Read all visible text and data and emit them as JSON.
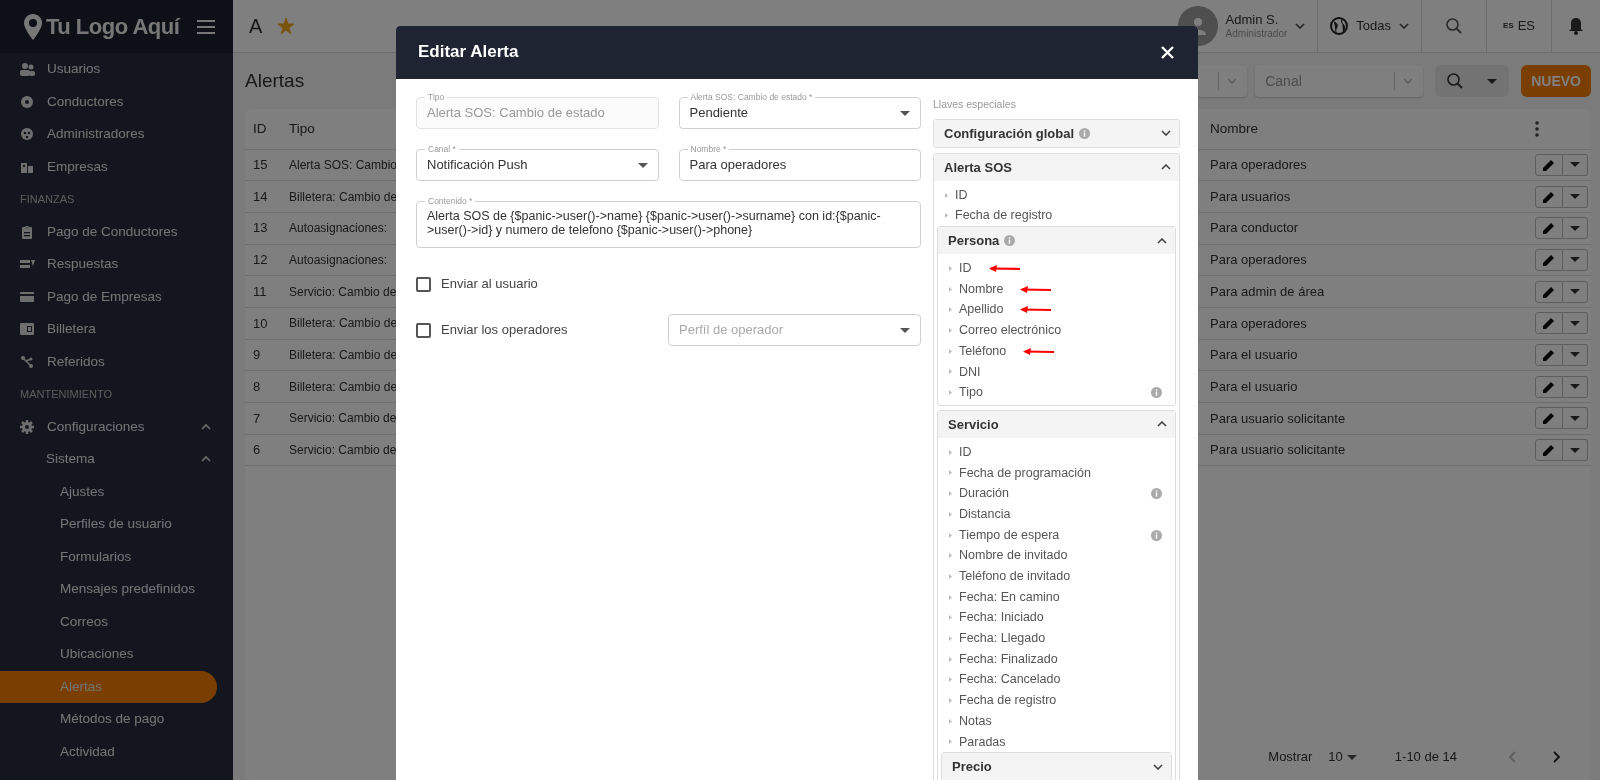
{
  "sidebar": {
    "logo": "Tu Logo Aquí",
    "nav": [
      {
        "kind": "item",
        "label": "Usuarios"
      },
      {
        "kind": "item",
        "label": "Conductores"
      },
      {
        "kind": "item",
        "label": "Administradores"
      },
      {
        "kind": "item",
        "label": "Empresas"
      },
      {
        "kind": "section",
        "label": "FINANZAS"
      },
      {
        "kind": "item",
        "label": "Pago de Conductores"
      },
      {
        "kind": "item",
        "label": "Respuestas"
      },
      {
        "kind": "item",
        "label": "Pago de Empresas"
      },
      {
        "kind": "item",
        "label": "Billetera"
      },
      {
        "kind": "item",
        "label": "Referidos"
      },
      {
        "kind": "section",
        "label": "MANTENIMIENTO"
      },
      {
        "kind": "item",
        "label": "Configuraciones",
        "expanded": true,
        "children": [
          {
            "kind": "item",
            "label": "Sistema",
            "expanded": true,
            "children": [
              {
                "kind": "item",
                "label": "Ajustes",
                "selected": false
              },
              {
                "kind": "item",
                "label": "Perfiles de usuario",
                "selected": false
              },
              {
                "kind": "item",
                "label": "Formularios",
                "selected": false
              },
              {
                "kind": "item",
                "label": "Mensajes predefinidos",
                "selected": false
              },
              {
                "kind": "item",
                "label": "Correos",
                "selected": false
              },
              {
                "kind": "item",
                "label": "Ubicaciones",
                "selected": false
              },
              {
                "kind": "item",
                "label": "Alertas",
                "selected": true
              },
              {
                "kind": "item",
                "label": "Métodos de pago",
                "selected": false
              },
              {
                "kind": "item",
                "label": "Actividad",
                "selected": false
              }
            ]
          }
        ]
      }
    ]
  },
  "topbar": {
    "app_initial": "A",
    "favorite": true,
    "user": {
      "name": "Admin S.",
      "role": "Administrador"
    },
    "scope": "Todas",
    "language": {
      "flag": "ES",
      "label": "ES"
    }
  },
  "page": {
    "title": "Alertas",
    "filters": [
      {
        "kind": "select"
      },
      {
        "kind": "select",
        "placeholder": "Canal"
      }
    ],
    "new_button": "NUEVO"
  },
  "table": {
    "columns": [
      "ID",
      "Tipo",
      "Nombre"
    ],
    "rows": [
      {
        "id": "15",
        "type": "Alerta SOS: Cambio",
        "name": "Para operadores"
      },
      {
        "id": "14",
        "type": "Billetera: Cambio de",
        "name": "Para usuarios"
      },
      {
        "id": "13",
        "type": "Autoasignaciones:",
        "name": "Para conductor"
      },
      {
        "id": "12",
        "type": "Autoasignaciones:",
        "name": "Para operadores"
      },
      {
        "id": "11",
        "type": "Servicio: Cambio de",
        "name": "Para admin de área"
      },
      {
        "id": "10",
        "type": "Billetera: Cambio de",
        "name": "Para operadores"
      },
      {
        "id": "9",
        "type": "Billetera: Cambio de",
        "name": "Para el usuario"
      },
      {
        "id": "8",
        "type": "Billetera: Cambio de",
        "name": "Para el usuario"
      },
      {
        "id": "7",
        "type": "Servicio: Cambio de",
        "name": "Para usuario solicitante"
      },
      {
        "id": "6",
        "type": "Servicio: Cambio de",
        "name": "Para usuario solicitante"
      }
    ]
  },
  "pagination": {
    "show_label": "Mostrar",
    "page_size": "10",
    "range": "1-10 de 14",
    "previous": {
      "disabled": true
    },
    "next": {
      "disabled": false
    }
  },
  "modal": {
    "title": "Editar Alerta",
    "fields": [
      {
        "kind": "text",
        "label": "Tipo",
        "value": "Alerta SOS: Cambio de estado",
        "disabled": true
      },
      {
        "kind": "select",
        "label": "Alerta SOS: Cambio de estado *",
        "value": "Pendiente"
      },
      {
        "kind": "select",
        "label": "Canal *",
        "value": "Notificación Push"
      },
      {
        "kind": "text",
        "label": "Nombre *",
        "value": "Para operadores",
        "disabled": false
      },
      {
        "kind": "textarea",
        "label": "Contenido *",
        "value": "Alerta SOS de {$panic->user()->name} {$panic->user()->surname} con id:{$panic->user()->id} y numero de telefono {$panic->user()->phone}"
      }
    ],
    "checkboxes": [
      {
        "label": "Enviar al usuario",
        "checked": false
      },
      {
        "label": "Enviar los operadores",
        "checked": false,
        "select": {
          "placeholder": "Perfíl de operador"
        }
      }
    ],
    "keys": {
      "label": "Llaves especiales",
      "groups": [
        {
          "title": "Configuración global",
          "info": true,
          "expanded": false
        },
        {
          "title": "Alerta SOS",
          "expanded": true,
          "items": [
            {
              "label": "ID"
            },
            {
              "label": "Fecha de registro"
            }
          ],
          "children": [
            {
              "title": "Persona",
              "info": true,
              "expanded": true,
              "items": [
                {
                  "label": "ID",
                  "marked": true
                },
                {
                  "label": "Nombre",
                  "marked": true
                },
                {
                  "label": "Apellido",
                  "marked": true
                },
                {
                  "label": "Correo electrónico"
                },
                {
                  "label": "Teléfono",
                  "marked": true
                },
                {
                  "label": "DNI"
                },
                {
                  "label": "Tipo",
                  "info": true
                }
              ]
            },
            {
              "title": "Servicio",
              "expanded": true,
              "items": [
                {
                  "label": "ID"
                },
                {
                  "label": "Fecha de programación"
                },
                {
                  "label": "Duración",
                  "info": true
                },
                {
                  "label": "Distancia"
                },
                {
                  "label": "Tiempo de espera",
                  "info": true
                },
                {
                  "label": "Nombre de invitado"
                },
                {
                  "label": "Teléfono de invitado"
                },
                {
                  "label": "Fecha: En camino"
                },
                {
                  "label": "Fecha: Iniciado"
                },
                {
                  "label": "Fecha: Llegado"
                },
                {
                  "label": "Fecha: Finalizado"
                },
                {
                  "label": "Fecha: Cancelado"
                },
                {
                  "label": "Fecha de registro"
                },
                {
                  "label": "Notas"
                },
                {
                  "label": "Paradas"
                }
              ],
              "children": [
                {
                  "title": "Precio",
                  "expanded": false
                }
              ]
            }
          ]
        }
      ]
    }
  }
}
